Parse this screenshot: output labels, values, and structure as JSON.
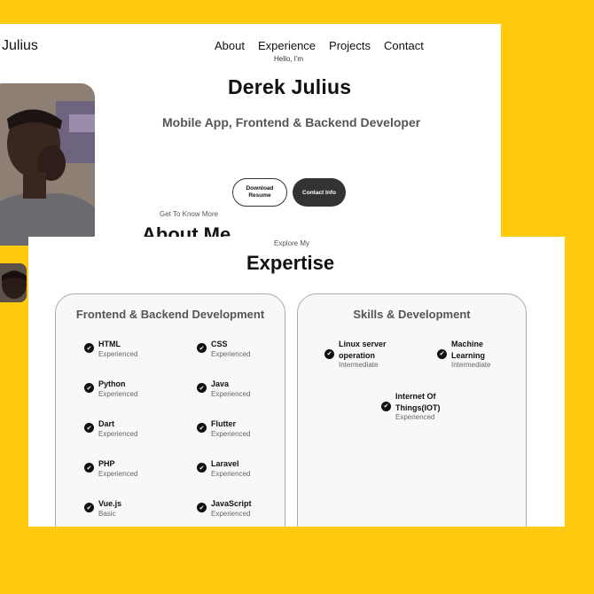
{
  "header": {
    "logo": "Julius",
    "nav": [
      "About",
      "Experience",
      "Projects",
      "Contact"
    ]
  },
  "hero": {
    "hello": "Hello, I'm",
    "name": "Derek Julius",
    "role": "Mobile App, Frontend & Backend Developer",
    "download_label": "Download\nResume",
    "contact_label": "Contact Info"
  },
  "about": {
    "subtitle": "Get To Know More",
    "title": "About Me"
  },
  "expertise": {
    "subtitle": "Explore My",
    "title": "Expertise",
    "cards": [
      {
        "title": "Frontend & Backend Development",
        "skills": [
          {
            "name": "HTML",
            "level": "Experienced"
          },
          {
            "name": "CSS",
            "level": "Experienced"
          },
          {
            "name": "Python",
            "level": "Experienced"
          },
          {
            "name": "Java",
            "level": "Experienced"
          },
          {
            "name": "Dart",
            "level": "Experienced"
          },
          {
            "name": "Flutter",
            "level": "Experienced"
          },
          {
            "name": "PHP",
            "level": "Experienced"
          },
          {
            "name": "Laravel",
            "level": "Experienced"
          },
          {
            "name": "Vue.js",
            "level": "Basic"
          },
          {
            "name": "JavaScript",
            "level": "Experienced"
          }
        ]
      },
      {
        "title": "Skills & Development",
        "skills": [
          {
            "name": "Linux server operation",
            "level": "Intermediate"
          },
          {
            "name": "Machine Learning",
            "level": "Intermediate"
          },
          {
            "name": "Internet Of Things(IOT)",
            "level": "Experienced"
          }
        ]
      }
    ]
  },
  "colors": {
    "background": "#FFC90E",
    "button_dark": "#333333"
  }
}
